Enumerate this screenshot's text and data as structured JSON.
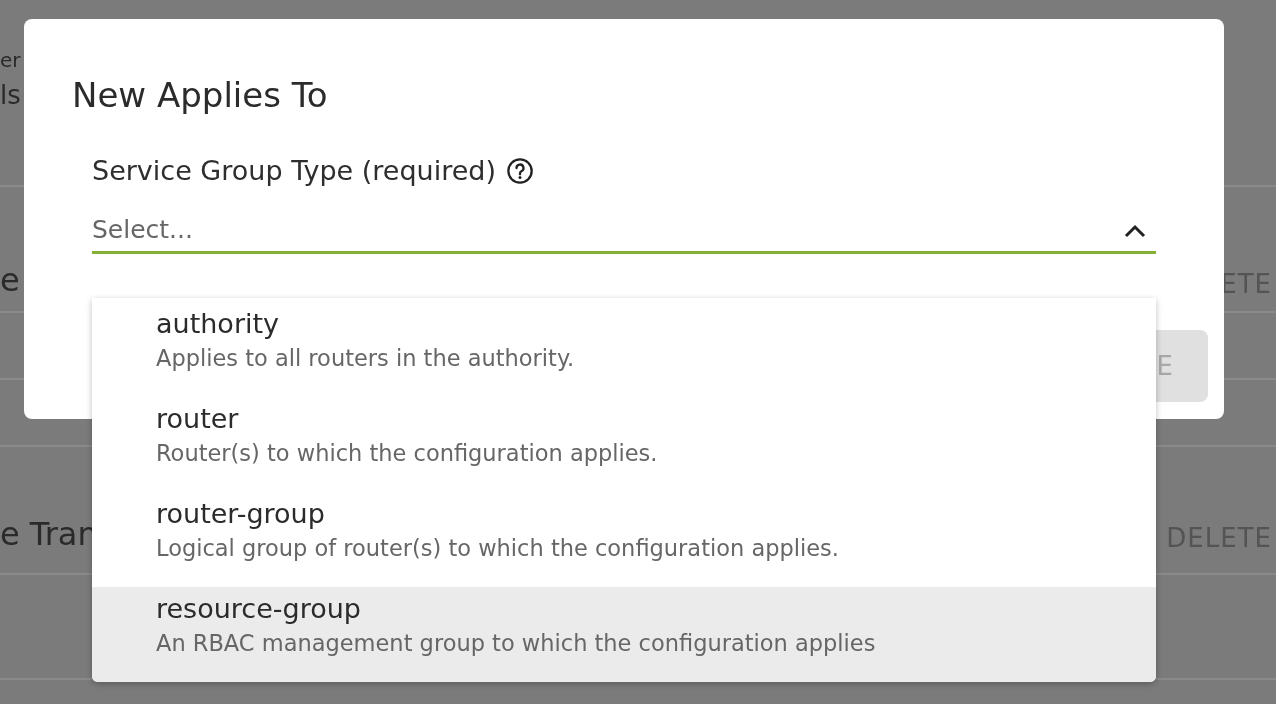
{
  "background": {
    "rows": [
      {
        "left": "er",
        "right": ""
      },
      {
        "left": "ls",
        "right": ""
      },
      {
        "left": "e",
        "right": "ETE"
      },
      {
        "left": "",
        "right": ""
      },
      {
        "left": "",
        "right": ""
      },
      {
        "left": "e Tran",
        "right": "DELETE"
      },
      {
        "left": "",
        "right": ""
      }
    ]
  },
  "dialog": {
    "title": "New Applies To",
    "field": {
      "label": "Service Group Type (required)",
      "placeholder": "Select...",
      "focused": true,
      "expanded": true
    },
    "button": {
      "label": "E",
      "disabled": true
    },
    "options": [
      {
        "name": "authority",
        "description": "Applies to all routers in the authority.",
        "selected": false
      },
      {
        "name": "router",
        "description": "Router(s) to which the configuration applies.",
        "selected": false
      },
      {
        "name": "router-group",
        "description": "Logical group of router(s) to which the configuration applies.",
        "selected": false
      },
      {
        "name": "resource-group",
        "description": "An RBAC management group to which the configuration applies",
        "selected": true
      }
    ]
  }
}
